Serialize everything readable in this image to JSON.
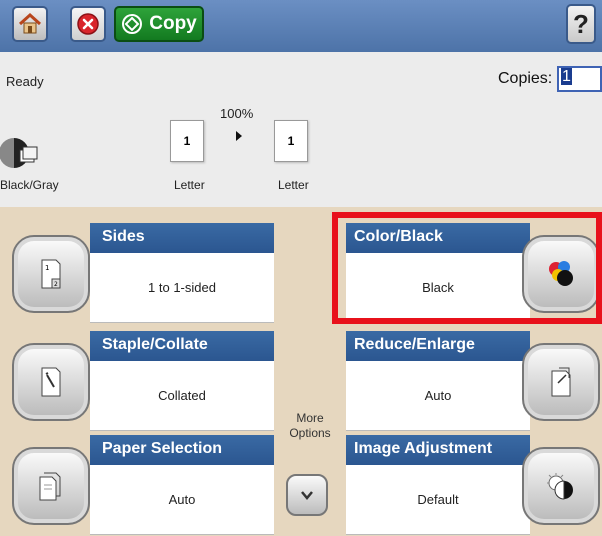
{
  "topbar": {
    "copy_label": "Copy",
    "help_label": "?"
  },
  "status": {
    "text": "Ready",
    "copies_label": "Copies:",
    "copies_value": "1"
  },
  "preview": {
    "zoom": "100%",
    "input_page_number": "1",
    "output_page_number": "1",
    "input_size": "Letter",
    "output_size": "Letter",
    "color_mode_label": "Black/Gray"
  },
  "options": {
    "sides": {
      "title": "Sides",
      "value": "1 to 1-sided"
    },
    "staple": {
      "title": "Staple/Collate",
      "value": "Collated"
    },
    "paper": {
      "title": "Paper Selection",
      "value": "Auto"
    },
    "color": {
      "title": "Color/Black",
      "value": "Black"
    },
    "reduce": {
      "title": "Reduce/Enlarge",
      "value": "Auto"
    },
    "image": {
      "title": "Image Adjustment",
      "value": "Default"
    },
    "more_options_label": "More Options"
  },
  "colors": {
    "header_blue": "#2b5690",
    "panel_bg": "#e6d7bf",
    "highlight_red": "#e8111b",
    "copy_green": "#1e8a2b"
  },
  "icons": {
    "home": "home-icon",
    "stop": "stop-icon",
    "start": "start-icon",
    "help": "help-icon",
    "more": "chevron-down-icon"
  }
}
